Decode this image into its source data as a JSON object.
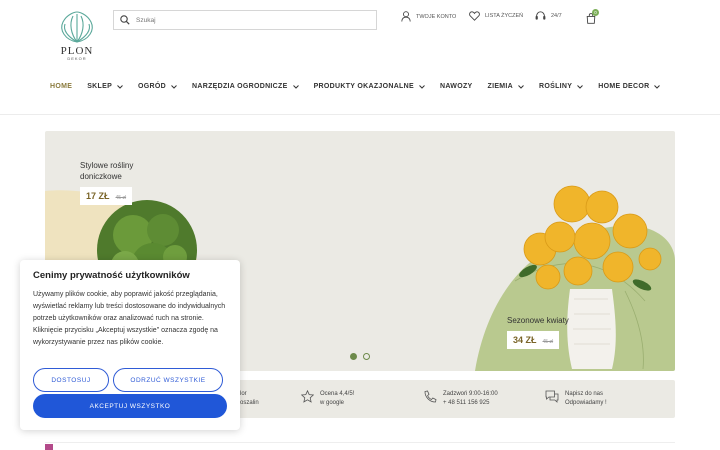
{
  "brand": {
    "name": "PLON",
    "sub": "DEKOR",
    "accent": "#7cae58"
  },
  "search": {
    "placeholder": "Szukaj"
  },
  "header": {
    "account": "TWOJE KONTO",
    "wishlist": "LISTA ŻYCZEŃ",
    "hours": "24/7",
    "cart_count": "0"
  },
  "nav": [
    {
      "label": "HOME",
      "dropdown": false
    },
    {
      "label": "SKLEP",
      "dropdown": true
    },
    {
      "label": "OGRÓD",
      "dropdown": true
    },
    {
      "label": "NARZĘDZIA OGRODNICZE",
      "dropdown": true
    },
    {
      "label": "PRODUKTY OKAZJONALNE",
      "dropdown": true
    },
    {
      "label": "NAWOZY",
      "dropdown": false
    },
    {
      "label": "ZIEMIA",
      "dropdown": true
    },
    {
      "label": "ROŚLINY",
      "dropdown": true
    },
    {
      "label": "HOME DECOR",
      "dropdown": true
    }
  ],
  "hero": {
    "left": {
      "title_line1": "Stylowe rośliny",
      "title_line2": "doniczkowe",
      "price": "17 ZŁ",
      "old_price": "45 zł"
    },
    "right": {
      "title": "Sezonowe kwiaty",
      "price": "34 ZŁ",
      "old_price": "45 zł"
    },
    "slides_active": 1
  },
  "features": [
    {
      "icon": "star-icon",
      "line1": "Ocena 4,4/5!",
      "line2": "w google"
    },
    {
      "icon": "phone-icon",
      "line1": "Zadzwoń 9:00-16:00",
      "line2": "+ 48 511 156 925"
    },
    {
      "icon": "chat-icon",
      "line1": "Napisz do nas",
      "line2": "Odpowiadamy !"
    }
  ],
  "features_partial": {
    "line1": "lor",
    "line2": "oszalin"
  },
  "cookie": {
    "title": "Cenimy prywatność użytkowników",
    "text": "Używamy plików cookie, aby poprawić jakość przeglądania, wyświetlać reklamy lub treści dostosowane do indywidualnych potrzeb użytkowników oraz analizować ruch na stronie. Kliknięcie przycisku „Akceptuj wszystkie\" oznacza zgodę na wykorzystywanie przez nas plików cookie.",
    "btn_customize": "DOSTOSUJ",
    "btn_reject": "ODRZUĆ WSZYSTKIE",
    "btn_accept": "AKCEPTUJ WSZYSTKO",
    "button_color": "#2057d8"
  }
}
